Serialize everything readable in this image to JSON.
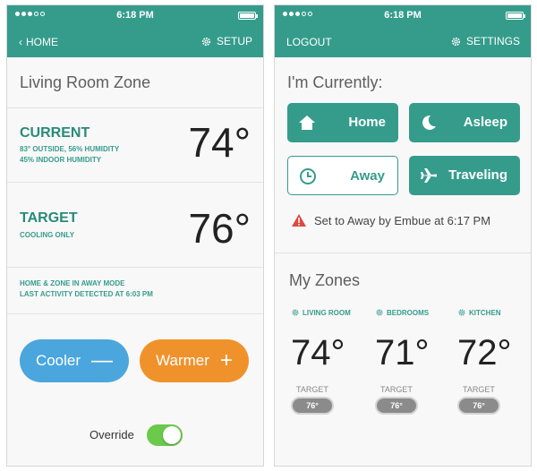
{
  "status_bar": {
    "time": "6:18 PM"
  },
  "left": {
    "back_label": "HOME",
    "setup_label": "SETUP",
    "zone_title": "Living Room Zone",
    "current": {
      "label": "CURRENT",
      "detail_1": "83° OUTSIDE, 56% HUMIDITY",
      "detail_2": "45% INDOOR HUMIDITY",
      "temp": "74°"
    },
    "target": {
      "label": "TARGET",
      "detail": "COOLING ONLY",
      "temp": "76°"
    },
    "info_1": "HOME & ZONE IN AWAY MODE",
    "info_2": "LAST ACTIVITY DETECTED AT 6:03 PM",
    "cooler_label": "Cooler",
    "cooler_sign": "—",
    "warmer_label": "Warmer",
    "warmer_sign": "+",
    "override_label": "Override",
    "override_on": true
  },
  "right": {
    "logout_label": "LOGOUT",
    "settings_label": "SETTINGS",
    "currently_title": "I'm Currently:",
    "modes": [
      {
        "label": "Home",
        "icon": "house-icon",
        "selected": true
      },
      {
        "label": "Asleep",
        "icon": "moon-icon",
        "selected": true
      },
      {
        "label": "Away",
        "icon": "clock-icon",
        "selected": false
      },
      {
        "label": "Traveling",
        "icon": "airplane-icon",
        "selected": true
      }
    ],
    "alert_text": "Set to Away by Embue at 6:17 PM",
    "zones_title": "My Zones",
    "zones": [
      {
        "name": "LIVING ROOM",
        "temp": "74°",
        "target_label": "TARGET",
        "target": "76°"
      },
      {
        "name": "BEDROOMS",
        "temp": "71°",
        "target_label": "TARGET",
        "target": "76°"
      },
      {
        "name": "KITCHEN",
        "temp": "72°",
        "target_label": "TARGET",
        "target": "76°"
      }
    ]
  },
  "colors": {
    "header": "#359c8c",
    "teal_text": "#2a8a7a",
    "cooler": "#4aa6dd",
    "warmer": "#f0922c",
    "toggle_on": "#6bc94b",
    "alert": "#e0483e"
  }
}
